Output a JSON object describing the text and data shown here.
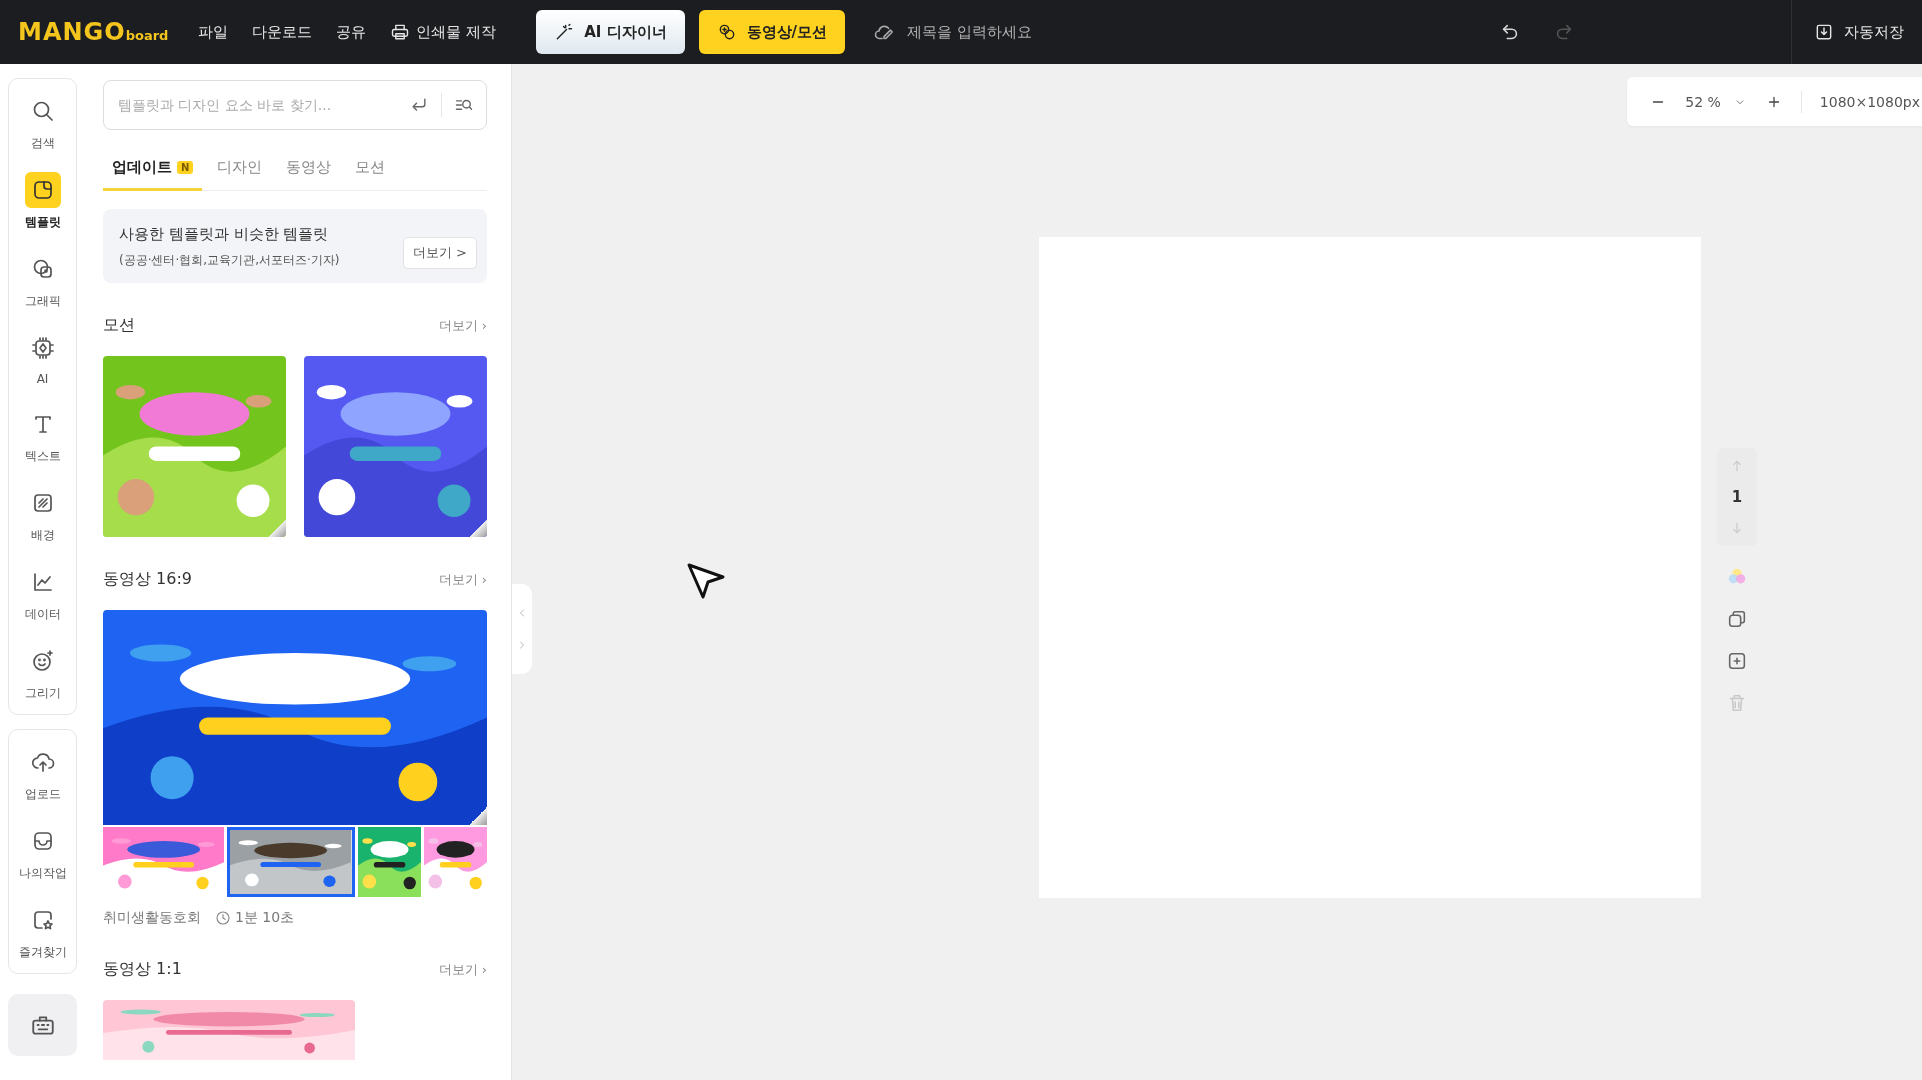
{
  "top_bar": {
    "logo": {
      "main": "MANGO",
      "sub": "board"
    },
    "menu": [
      {
        "label": "파일",
        "kind": "text"
      },
      {
        "label": "다운로드",
        "kind": "text"
      },
      {
        "label": "공유",
        "kind": "text"
      },
      {
        "label": "인쇄물 제작",
        "kind": "print"
      }
    ],
    "modes": [
      {
        "label": "AI 디자이너",
        "kind": "ai",
        "selected": false
      },
      {
        "label": "동영상/모션",
        "kind": "motion",
        "selected": true
      }
    ],
    "title_field": {
      "placeholder": "제목을 입력하세요"
    },
    "undo": {
      "disabled": false
    },
    "redo": {
      "disabled": true
    },
    "save_button": "자동저장"
  },
  "rail": {
    "groups": [
      [
        {
          "label": "검색",
          "selected": false
        },
        {
          "label": "템플릿",
          "selected": true
        },
        {
          "label": "그래픽",
          "selected": false
        },
        {
          "label": "AI",
          "selected": false
        },
        {
          "label": "텍스트",
          "selected": false
        },
        {
          "label": "배경",
          "selected": false
        },
        {
          "label": "데이터",
          "selected": false
        },
        {
          "label": "그리기",
          "selected": false
        }
      ],
      [
        {
          "label": "업로드",
          "selected": false
        },
        {
          "label": "나의작업",
          "selected": false
        },
        {
          "label": "즐겨찾기",
          "selected": false
        }
      ]
    ]
  },
  "panel": {
    "search": {
      "placeholder": "템플릿과 디자인 요소 바로 찾기..."
    },
    "tabs": [
      {
        "label": "업데이트",
        "badge": "N",
        "selected": true
      },
      {
        "label": "디자인",
        "selected": false
      },
      {
        "label": "동영상",
        "selected": false
      },
      {
        "label": "모션",
        "selected": false
      }
    ],
    "promo": {
      "title": "사용한 템플릿과 비슷한 템플릿",
      "subtitle": "(공공·센터·협회,교육기관,서포터즈·기자)",
      "button": "더보기 >"
    },
    "sections": [
      {
        "title": "모션",
        "more": "더보기 ›",
        "kind": "grid"
      },
      {
        "title": "동영상 16:9",
        "more": "더보기 ›",
        "kind": "video",
        "caption": {
          "name": "취미생활동호회",
          "duration": "1분 10초"
        }
      },
      {
        "title": "동영상 1:1",
        "more": "더보기 ›",
        "kind": "single"
      }
    ]
  },
  "zoom_bar": {
    "zoom": "52 %",
    "size": "1080×1080px"
  },
  "page_tools": {
    "page": "1"
  }
}
